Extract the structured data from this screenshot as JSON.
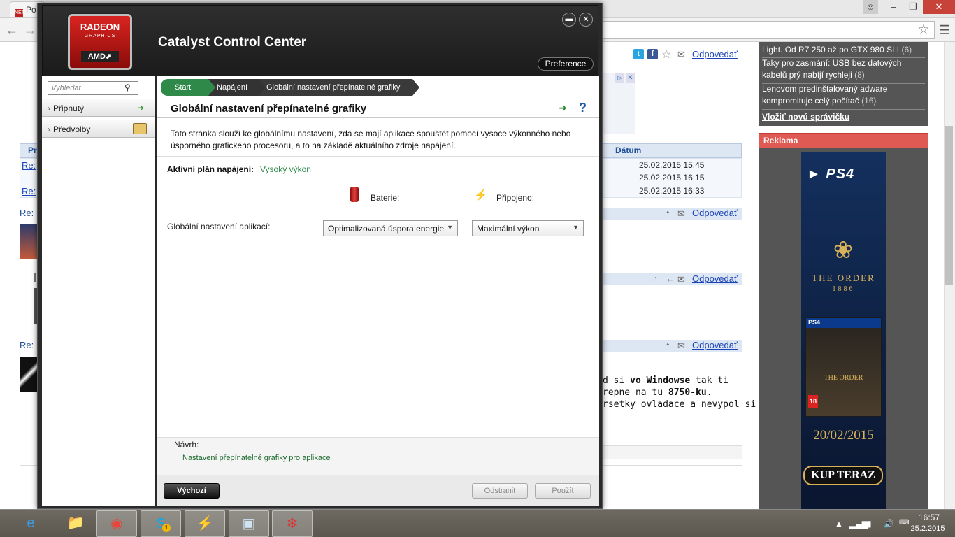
{
  "browser": {
    "tab_title": "Po",
    "tab_favicon": "NET",
    "window_controls": {
      "user": "☺",
      "minimize": "–",
      "restore": "❐",
      "close": "✕"
    }
  },
  "page": {
    "article_actions": {
      "reply": "Odpovedať"
    },
    "table": {
      "col_short": "Pr",
      "col_date": "Dátum",
      "rows": [
        {
          "label": "Re:",
          "date": "25.02.2015 15:45"
        },
        {
          "label": "",
          "date": "25.02.2015 16:15"
        },
        {
          "label": "Re:",
          "date": "25.02.2015 16:33"
        }
      ]
    },
    "posts": [
      {
        "label": "Re:",
        "reply": "Odpovedať"
      },
      {
        "label": "",
        "reply": "Odpovedať"
      },
      {
        "label": "Re:",
        "reply": "Odpovedať"
      }
    ],
    "visible_post_text": {
      "line1_a": "d si ",
      "line1_b": "vo Windowse",
      "line1_c": " tak ti",
      "line2_a": "repne na tu ",
      "line2_b": "8750-ku",
      "line2_c": ".",
      "line3": "rsetky ovladace a nevypol si"
    },
    "news": {
      "items": [
        {
          "text": "Light. Od R7 250 až po GTX 980 SLI",
          "count": "(6)"
        },
        {
          "text": "Taky pro zasmání: USB bez datových kabelů prý nabíjí rychleji",
          "count": "(8)"
        },
        {
          "text": "Lenovom predinštalovaný adware kompromituje celý počítač",
          "count": "(16)"
        }
      ],
      "add_link": "Vložiť novú správičku"
    },
    "ad": {
      "header": "Reklama",
      "brand": "PS4",
      "game_title": "THE ORDER",
      "game_year": "1886",
      "pack_brand": "PS4",
      "pack_title": "THE ORDER",
      "pack_rating": "18",
      "release_date": "20/02/2015",
      "cta": "KUP TERAZ"
    }
  },
  "ccc": {
    "logo": {
      "line1": "RADEON",
      "line2": "GRAPHICS",
      "line3": "AMD⬈"
    },
    "title": "Catalyst Control Center",
    "preference_label": "Preference",
    "search_placeholder": "Vyhledat",
    "sidebar": [
      {
        "label": "Připnutý"
      },
      {
        "label": "Předvolby"
      }
    ],
    "breadcrumb": [
      "Start",
      "Napájení",
      "Globální nastavení přepínatelné grafiky"
    ],
    "page_title": "Globální nastavení přepínatelné grafiky",
    "description": "Tato stránka slouží ke globálnímu nastavení, zda se mají aplikace spouštět pomocí vysoce výkonného nebo úsporného grafického procesoru, a to na základě aktuálního zdroje napájení.",
    "plan_label": "Aktivní plán napájení:",
    "plan_value": "Vysoký výkon",
    "battery_label": "Baterie:",
    "plugged_label": "Připojeno:",
    "app_setting_label": "Globální nastavení aplikací:",
    "battery_select": "Optimalizovaná úspora energie",
    "plugged_select": "Maximální výkon",
    "hint_title": "Návrh:",
    "hint_link": "Nastavení přepínatelné grafiky pro aplikace",
    "default_btn": "Výchozí",
    "remove_btn": "Odstranit",
    "apply_btn": "Použít"
  },
  "taskbar": {
    "skype_badge": "1",
    "clock_time": "16:57",
    "clock_date": "25.2.2015"
  },
  "colors": {
    "amd_red": "#d92420",
    "ccc_green": "#2f8a4a",
    "ad_header": "#e05a54"
  }
}
